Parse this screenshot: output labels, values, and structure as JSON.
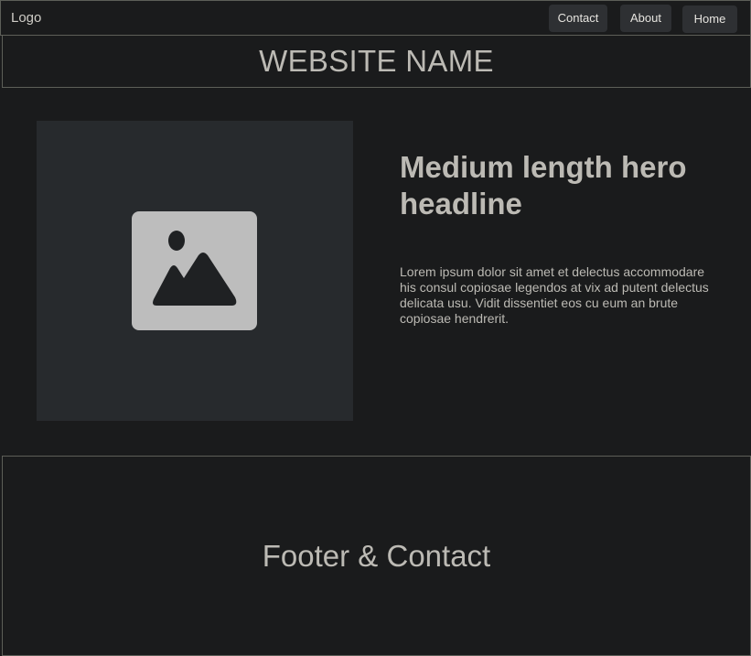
{
  "topbar": {
    "logo": "Logo",
    "nav": {
      "contact": "Contact",
      "about": "About",
      "home": "Home"
    }
  },
  "header": {
    "site_name": "WEBSITE NAME"
  },
  "hero": {
    "image_icon": "image-placeholder-icon",
    "headline": "Medium length hero headline",
    "body": "Lorem ipsum dolor sit amet et delectus accommodare his consul copiosae legendos at vix ad putent delectus delicata usu. Vidit dissentiet eos cu eum an brute copiosae hendrerit."
  },
  "footer": {
    "title": "Footer & Contact"
  },
  "colors": {
    "background": "#1a1b1c",
    "border": "#5d5f58",
    "button": "#2e3033",
    "image_placeholder": "#272a2d",
    "icon": "#bdbdbd",
    "text": "#bcbab4"
  }
}
